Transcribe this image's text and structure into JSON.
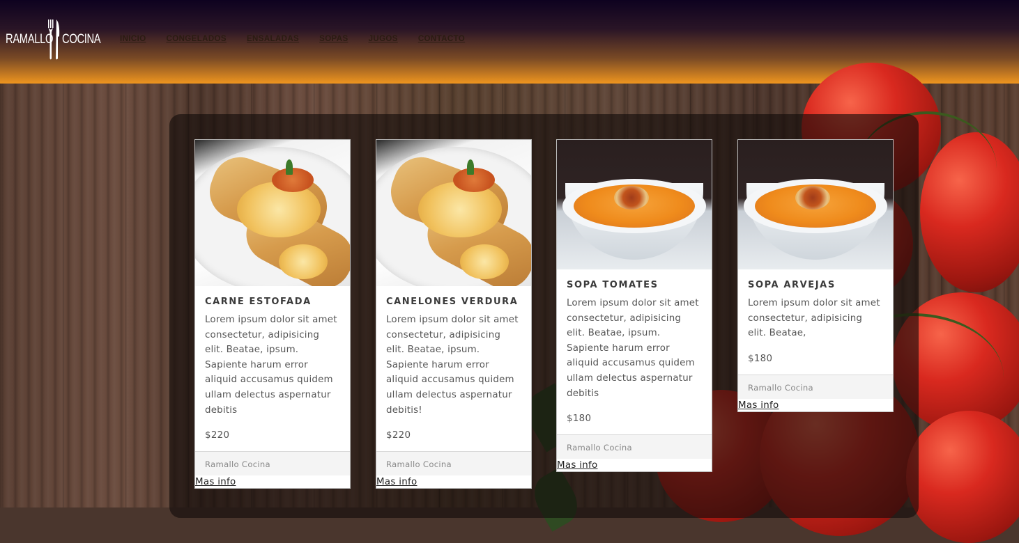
{
  "header": {
    "logo": {
      "word1": "RAMALLO",
      "word2": "COCINA"
    },
    "nav": [
      "INICIO",
      "CONGELADOS",
      "ENSALADAS",
      "SOPAS",
      "JUGOS",
      "CONTACTO"
    ]
  },
  "cards": [
    {
      "image": "crepe-photo",
      "title": "CARNE ESTOFADA",
      "description": "Lorem ipsum dolor sit amet consectetur, adipisicing elit. Beatae, ipsum. Sapiente harum error aliquid accusamus quidem ullam delectus aspernatur debitis",
      "price": "$220",
      "footer": "Ramallo Cocina",
      "link": "Mas info"
    },
    {
      "image": "crepe-photo",
      "title": "CANELONES VERDURA",
      "description": "Lorem ipsum dolor sit amet consectetur, adipisicing elit. Beatae, ipsum. Sapiente harum error aliquid accusamus quidem ullam delectus aspernatur debitis!",
      "price": "$220",
      "footer": "Ramallo Cocina",
      "link": "Mas info"
    },
    {
      "image": "soup-photo",
      "title": "SOPA TOMATES",
      "description": "Lorem ipsum dolor sit amet consectetur, adipisicing elit. Beatae, ipsum. Sapiente harum error aliquid accusamus quidem ullam delectus aspernatur debitis",
      "price": "$180",
      "footer": "Ramallo Cocina",
      "link": "Mas info"
    },
    {
      "image": "soup-photo",
      "title": "SOPA ARVEJAS",
      "description": "Lorem ipsum dolor sit amet consectetur, adipisicing elit. Beatae,",
      "price": "$180",
      "footer": "Ramallo Cocina",
      "link": "Mas info"
    }
  ],
  "colors": {
    "header_top": "#0e0220",
    "header_bottom": "#ef951f",
    "nav_text": "#2b1c12",
    "card_text": "#555555"
  }
}
